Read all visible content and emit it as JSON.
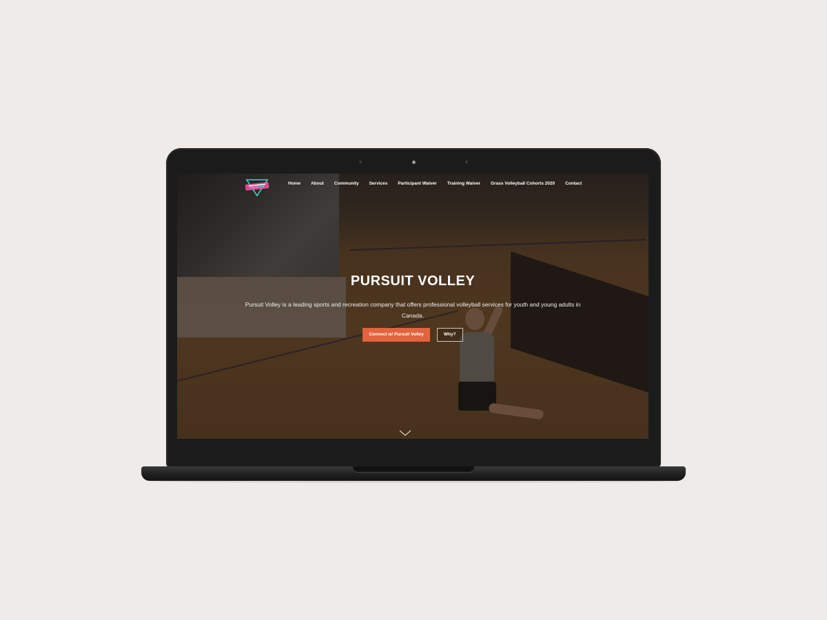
{
  "site": {
    "logo_text": "PURSUIT VOLLEY"
  },
  "nav": {
    "items": [
      {
        "label": "Home"
      },
      {
        "label": "About"
      },
      {
        "label": "Community"
      },
      {
        "label": "Services"
      },
      {
        "label": "Participant Waiver"
      },
      {
        "label": "Training Waiver"
      },
      {
        "label": "Grass Volleyball Cohorts 2020"
      },
      {
        "label": "Contact"
      }
    ]
  },
  "hero": {
    "title": "PURSUIT VOLLEY",
    "subtitle": "Pursuit Volley is a leading sports and recreation company that offers professional volleyball services for youth and young adults in Canada.",
    "primary_button": "Connect w/ Pursuit Volley",
    "secondary_button": "Why?"
  },
  "icons": {
    "scroll_down": "chevron-down-icon"
  },
  "colors": {
    "accent": "#e2633d",
    "logo_pink": "#ff4fa8",
    "logo_teal": "#3fd8c8",
    "background": "#efebe8",
    "laptop": "#1b1b1b"
  }
}
